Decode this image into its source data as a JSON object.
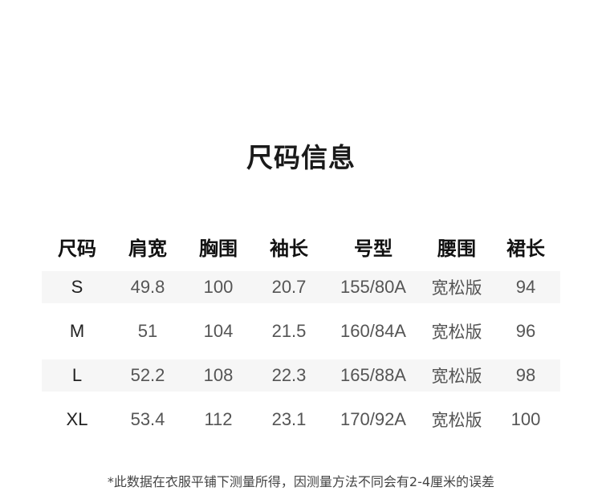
{
  "title": "尺码信息",
  "table": {
    "headers": [
      "尺码",
      "肩宽",
      "胸围",
      "袖长",
      "号型",
      "腰围",
      "裙长"
    ],
    "rows": [
      [
        "S",
        "49.8",
        "100",
        "20.7",
        "155/80A",
        "宽松版",
        "94"
      ],
      [
        "M",
        "51",
        "104",
        "21.5",
        "160/84A",
        "宽松版",
        "96"
      ],
      [
        "L",
        "52.2",
        "108",
        "22.3",
        "165/88A",
        "宽松版",
        "98"
      ],
      [
        "XL",
        "53.4",
        "112",
        "23.1",
        "170/92A",
        "宽松版",
        "100"
      ]
    ]
  },
  "note": "*此数据在衣服平铺下测量所得，因测量方法不同会有2-4厘米的误差",
  "colors": {
    "stripe": "#f6f6f6",
    "header_text": "#111111",
    "cell_text": "#555555"
  }
}
